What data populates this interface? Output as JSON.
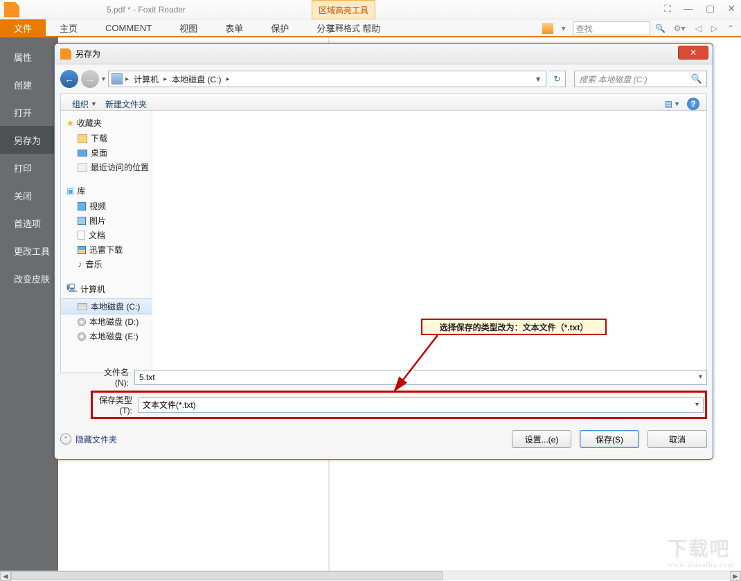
{
  "titlebar": {
    "title": "5.pdf * - Foxit Reader",
    "highlight_tool": "区域高亮工具"
  },
  "ribbon": {
    "tabs": [
      "文件",
      "主页",
      "COMMENT",
      "视图",
      "表单",
      "保护",
      "分享",
      "帮助"
    ],
    "annotation_format": "注释格式",
    "search_placeholder": "查找"
  },
  "left_panel": {
    "items": [
      "属性",
      "创建",
      "打开",
      "另存为",
      "打印",
      "关闭",
      "首选项",
      "更改工具",
      "改变皮肤"
    ],
    "selected_index": 3
  },
  "dialog": {
    "title": "另存为",
    "nav": {
      "path_computer": "计算机",
      "path_disk": "本地磁盘 (C:)",
      "search_placeholder": "搜索 本地磁盘 (C:)"
    },
    "toolbar": {
      "organize": "组织",
      "new_folder": "新建文件夹"
    },
    "tree": {
      "favorites": "收藏夹",
      "favorites_items": [
        "下载",
        "桌面",
        "最近访问的位置"
      ],
      "libraries": "库",
      "libraries_items": [
        "视频",
        "图片",
        "文档",
        "迅雷下载",
        "音乐"
      ],
      "computer": "计算机",
      "disks": [
        "本地磁盘 (C:)",
        "本地磁盘 (D:)",
        "本地磁盘 (E:)"
      ]
    },
    "callout": "选择保存的类型改为：文本文件（*.txt）",
    "filename_label": "文件名(N):",
    "filename_value": "5.txt",
    "filetype_label": "保存类型(T):",
    "filetype_value": "文本文件(*.txt)",
    "hide_folders": "隐藏文件夹",
    "buttons": {
      "settings": "设置...(e)",
      "save": "保存(S)",
      "cancel": "取消"
    }
  },
  "watermark": {
    "main": "下载吧",
    "sub": "www.xiazaiba.com"
  }
}
